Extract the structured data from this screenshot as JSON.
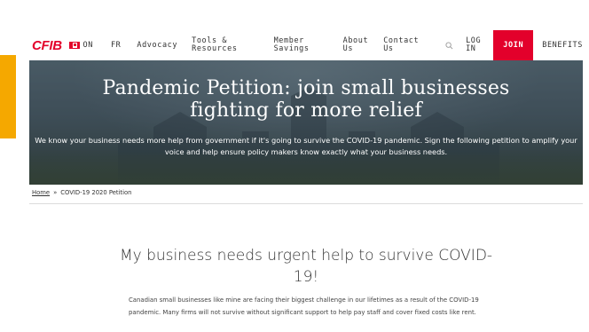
{
  "header": {
    "logo": "CFIB",
    "province": "ON",
    "language": "FR",
    "nav": {
      "advocacy": "Advocacy",
      "tools_line1": "Tools &",
      "tools_line2": "Resources",
      "member_line1": "Member",
      "member_line2": "Savings",
      "about_line1": "About",
      "about_line2": "Us",
      "contact_line1": "Contact",
      "contact_line2": "Us",
      "login_line1": "LOG",
      "login_line2": "IN",
      "join": "JOIN",
      "benefits": "BENEFITS"
    },
    "search_icon": "search-icon",
    "colors": {
      "brand_red": "#e3002b",
      "accent_yellow": "#f5a800"
    }
  },
  "hero": {
    "title": "Pandemic Petition: join small businesses fighting for more relief",
    "subtitle": "We know your business needs more help from government if it's going to survive the COVID-19 pandemic. Sign the following petition to amplify your voice and help ensure policy makers know exactly what your business needs."
  },
  "breadcrumb": {
    "home": "Home",
    "separator": "»",
    "current": "COVID-19 2020 Petition"
  },
  "main": {
    "title": "My business needs urgent help to survive COVID-19!",
    "body": "Canadian small businesses like mine are facing their biggest challenge in our lifetimes as a result of the COVID-19 pandemic. Many firms will not survive without significant support to help pay staff and cover fixed costs like rent."
  }
}
